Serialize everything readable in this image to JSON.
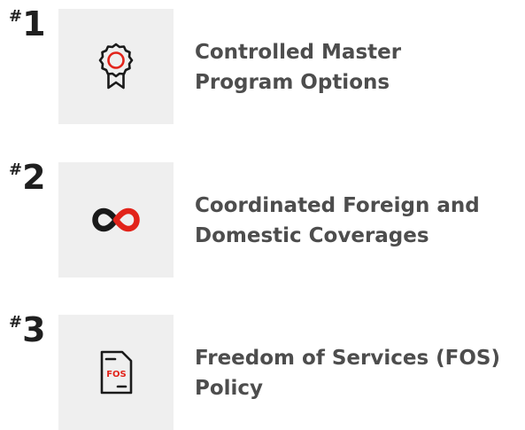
{
  "items": [
    {
      "rank_hash": "#",
      "rank_number": "1",
      "icon": "award-ribbon-icon",
      "title_lines": [
        "Controlled Master",
        "Program Options"
      ]
    },
    {
      "rank_hash": "#",
      "rank_number": "2",
      "icon": "linked-loops-icon",
      "title_lines": [
        "Coordinated Foreign and",
        "Domestic Coverages"
      ]
    },
    {
      "rank_hash": "#",
      "rank_number": "3",
      "icon": "fos-document-icon",
      "icon_text": "FOS",
      "title_lines": [
        "Freedom of Services (FOS)",
        "Policy"
      ]
    }
  ],
  "colors": {
    "accent": "#e2231a",
    "icon_dark": "#1a1a1a",
    "tile_background": "#efefef",
    "title_text": "#4d4d4d",
    "rank_text": "#1f1f1f"
  }
}
